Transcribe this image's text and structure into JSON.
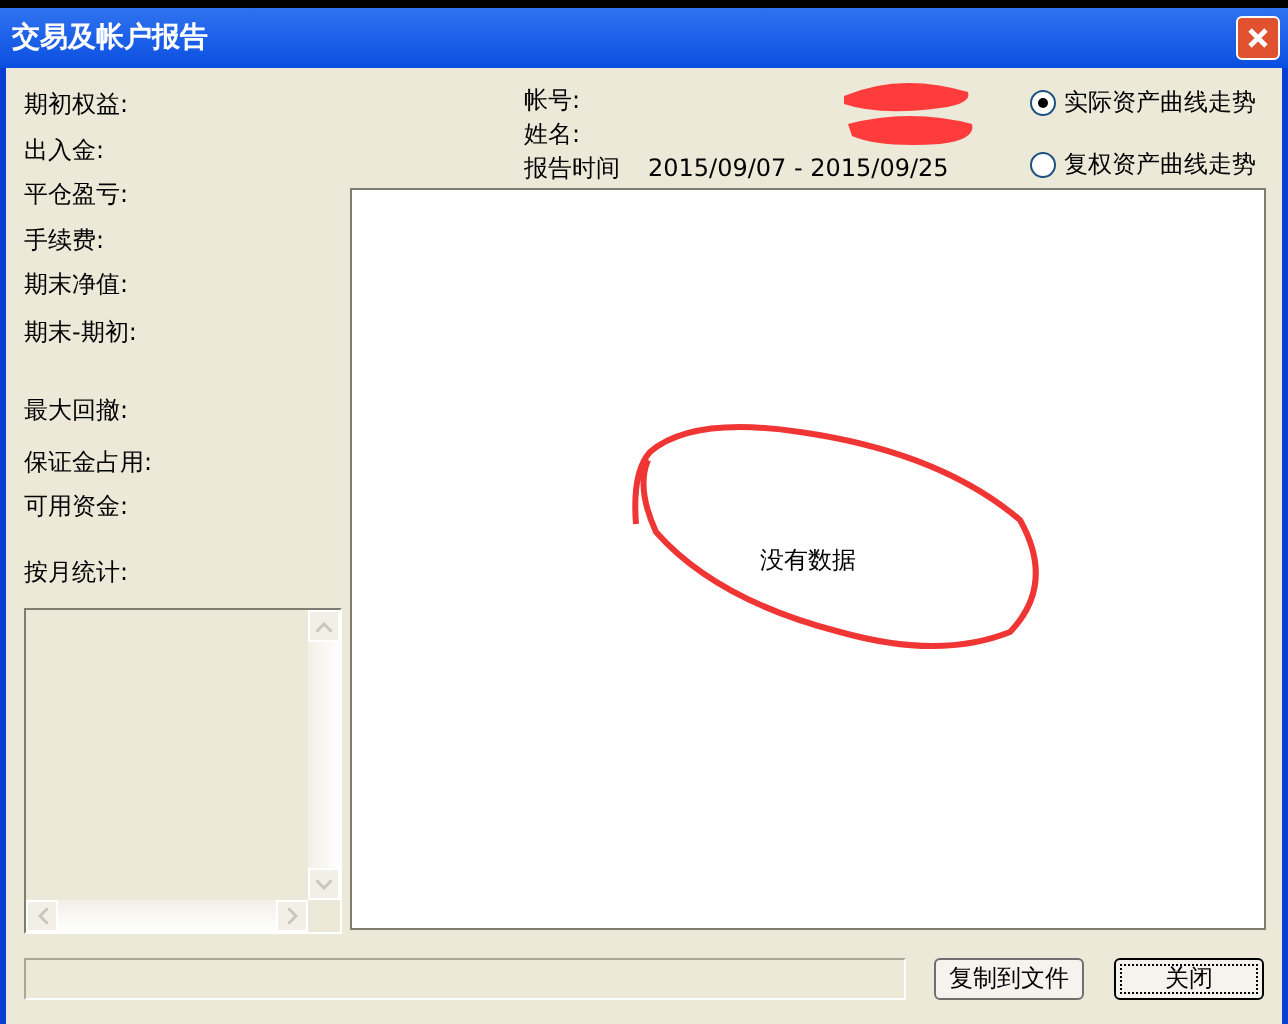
{
  "window": {
    "title": "交易及帐户报告"
  },
  "summary_labels": [
    "期初权益:",
    "出入金:",
    "平仓盈亏:",
    "手续费:",
    "期末净值:",
    "期末-期初:",
    "最大回撤:",
    "保证金占用:",
    "可用资金:",
    "按月统计:"
  ],
  "account": {
    "account_label": "帐号:",
    "name_label": "姓名:",
    "period_label": "报告时间",
    "period": "2015/09/07 - 2015/09/25"
  },
  "curve_options": [
    {
      "label": "实际资产曲线走势",
      "selected": true
    },
    {
      "label": "复权资产曲线走势",
      "selected": false
    }
  ],
  "chart": {
    "message": "没有数据"
  },
  "buttons": [
    {
      "label": "复制到文件",
      "focused": false
    },
    {
      "label": "关闭",
      "focused": true
    }
  ]
}
